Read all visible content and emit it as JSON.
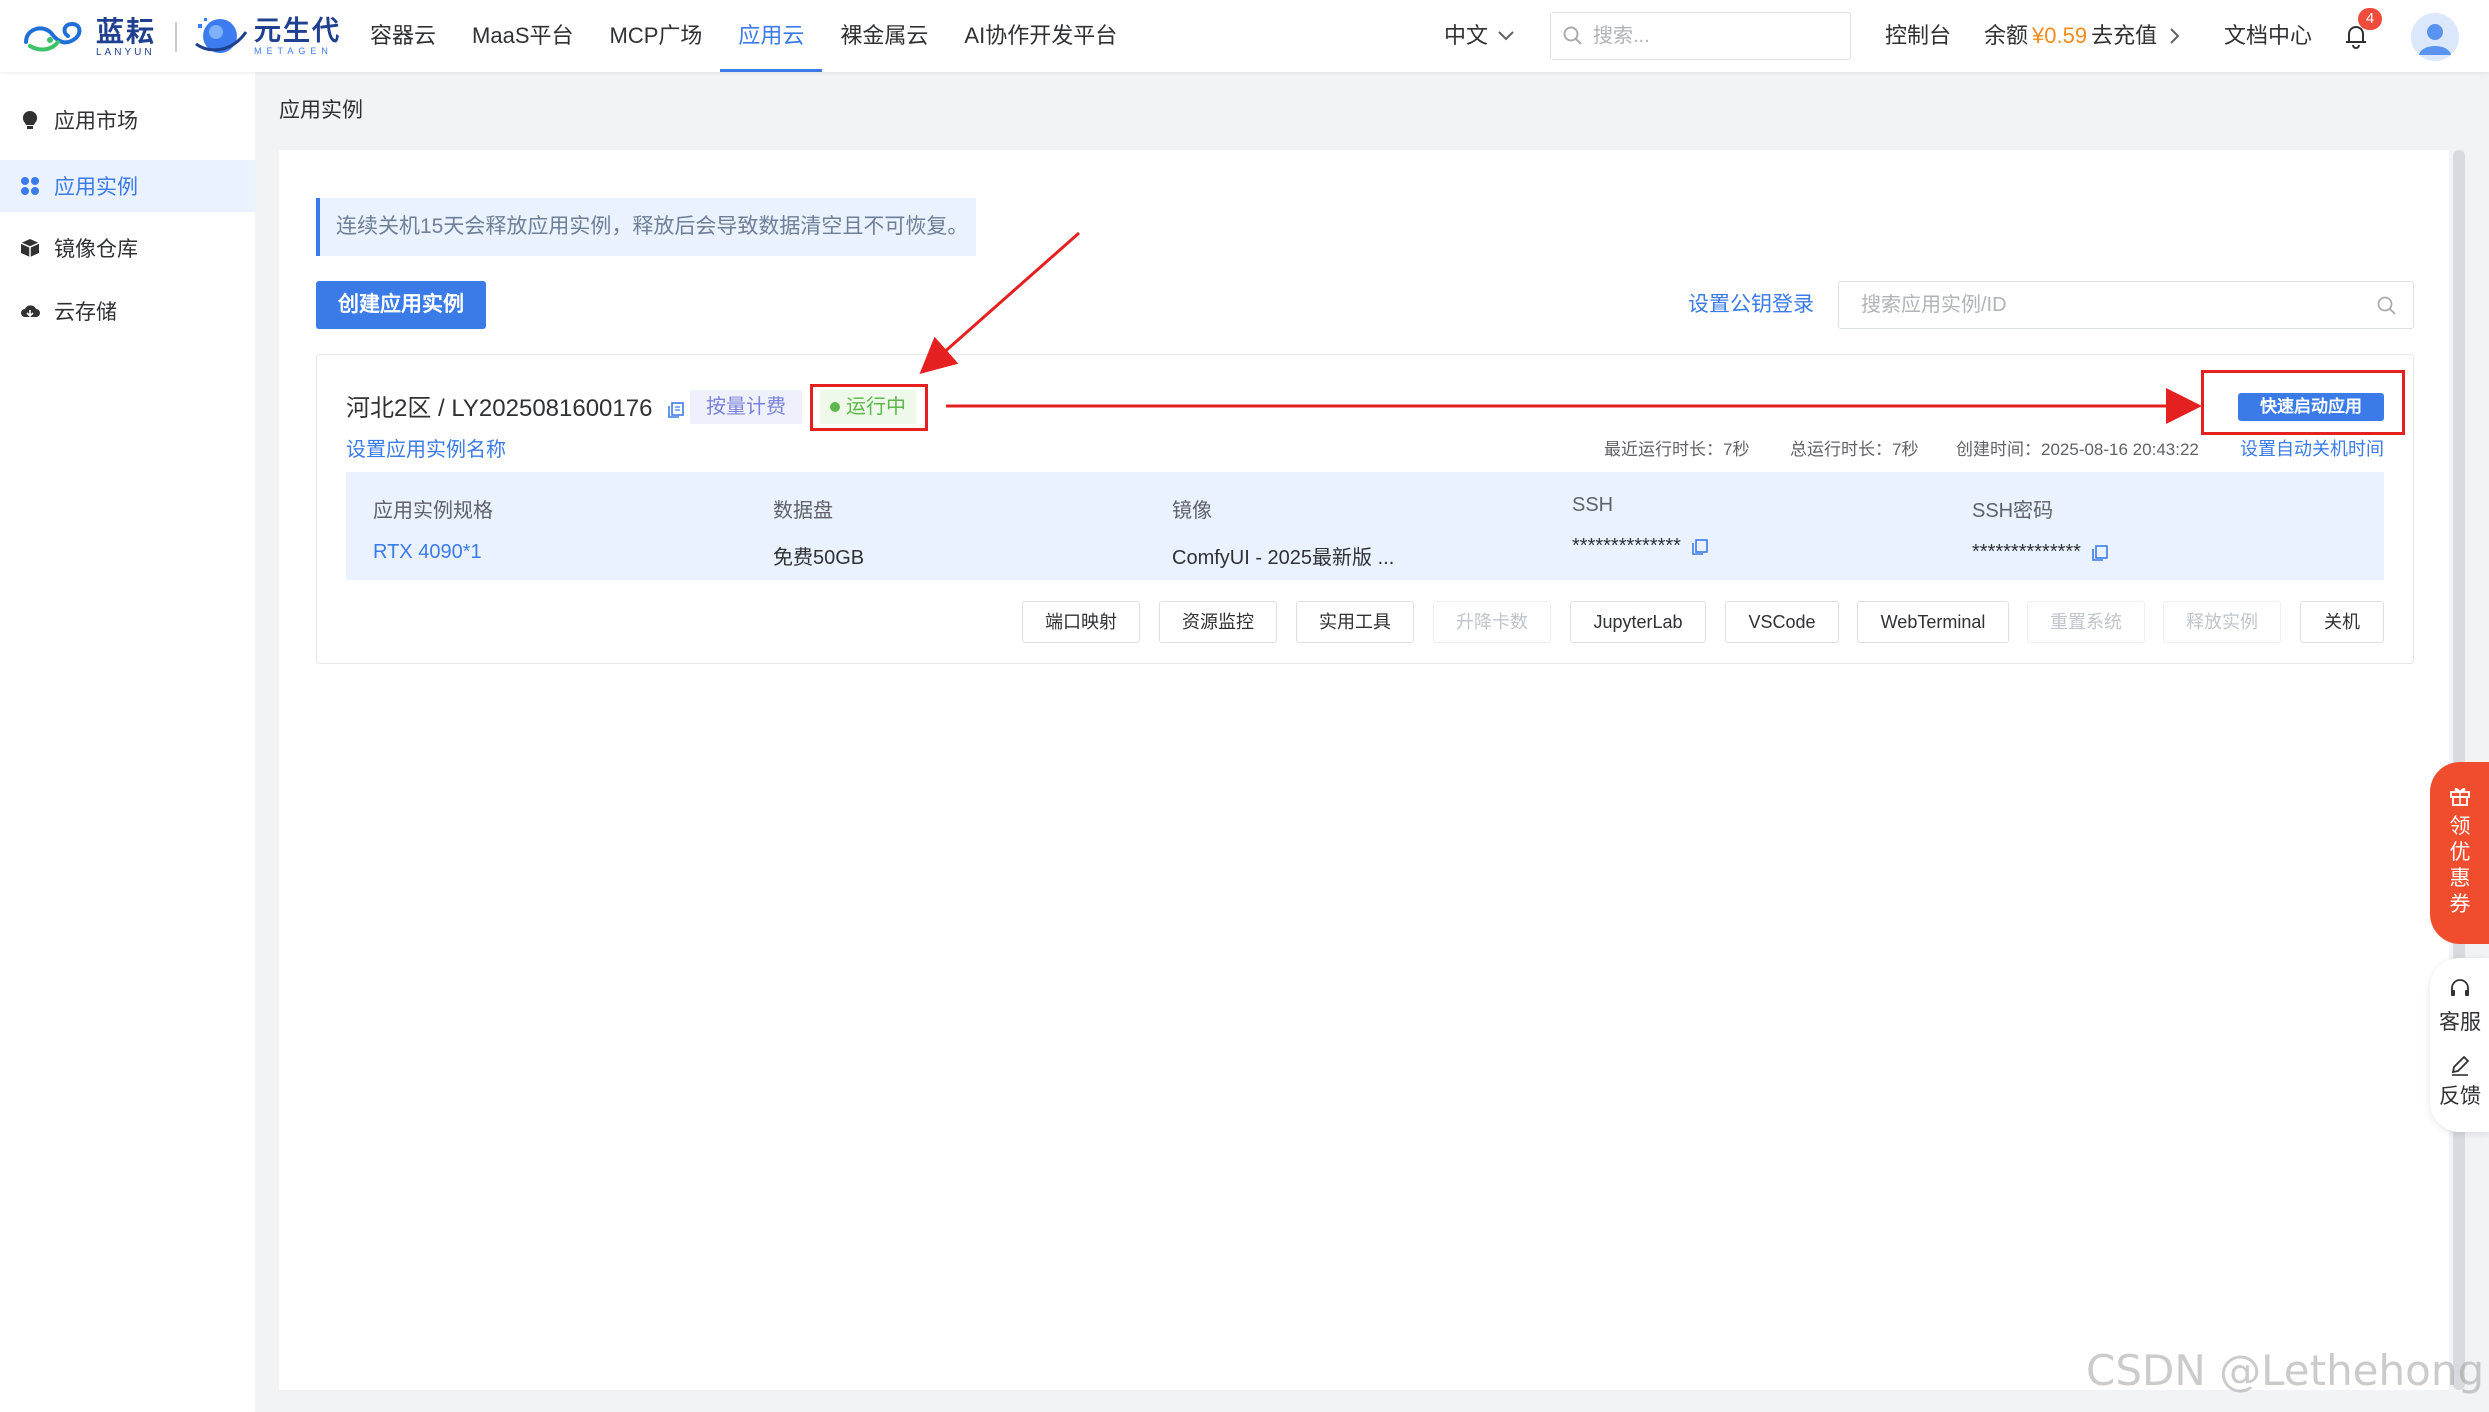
{
  "brand": {
    "logo1_cn": "蓝耘",
    "logo1_en": "LANYUN",
    "logo2_cn": "元生代",
    "logo2_en": "METAGEN"
  },
  "nav": {
    "items": [
      "容器云",
      "MaaS平台",
      "MCP广场",
      "应用云",
      "裸金属云",
      "AI协作开发平台"
    ],
    "active": "应用云"
  },
  "header": {
    "language": "中文",
    "search_placeholder": "搜索...",
    "console": "控制台",
    "balance_label": "余额",
    "balance_amount": "¥0.59",
    "recharge": "去充值",
    "docs": "文档中心",
    "notifications": "4"
  },
  "sidebar": {
    "items": [
      {
        "label": "应用市场",
        "icon": "lightbulb-icon"
      },
      {
        "label": "应用实例",
        "icon": "apps-icon"
      },
      {
        "label": "镜像仓库",
        "icon": "box-icon"
      },
      {
        "label": "云存储",
        "icon": "cloud-icon"
      }
    ],
    "active": "应用实例"
  },
  "page": {
    "breadcrumb": "应用实例",
    "notice": "连续关机15天会释放应用实例，释放后会导致数据清空且不可恢复。",
    "create_button": "创建应用实例",
    "pubkey_link": "设置公钥登录",
    "search_placeholder": "搜索应用实例/ID"
  },
  "instance": {
    "title": "河北2区 / LY2025081600176",
    "billing": "按量计费",
    "status": "运行中",
    "quick_launch": "快速启动应用",
    "rename": "设置应用实例名称",
    "recent_runtime": "最近运行时长：7秒",
    "total_runtime": "总运行时长：7秒",
    "created": "创建时间：2025-08-16 20:43:22",
    "auto_shutdown": "设置自动关机时间",
    "specs": [
      {
        "label": "应用实例规格",
        "value": "RTX 4090*1"
      },
      {
        "label": "数据盘",
        "value": "免费50GB"
      },
      {
        "label": "镜像",
        "value": "ComfyUI - 2025最新版 ..."
      },
      {
        "label": "SSH",
        "value": "**************"
      },
      {
        "label": "SSH密码",
        "value": "**************"
      }
    ],
    "actions": [
      {
        "label": "端口映射",
        "disabled": false
      },
      {
        "label": "资源监控",
        "disabled": false
      },
      {
        "label": "实用工具",
        "disabled": false
      },
      {
        "label": "升降卡数",
        "disabled": true
      },
      {
        "label": "JupyterLab",
        "disabled": false
      },
      {
        "label": "VSCode",
        "disabled": false
      },
      {
        "label": "WebTerminal",
        "disabled": false
      },
      {
        "label": "重置系统",
        "disabled": true
      },
      {
        "label": "释放实例",
        "disabled": true
      },
      {
        "label": "关机",
        "disabled": false
      }
    ]
  },
  "floating": {
    "coupon": [
      "领",
      "优",
      "惠",
      "券"
    ],
    "service": "客服",
    "feedback": "反馈"
  },
  "watermark": "CSDN @Lethehong",
  "colors": {
    "primary": "#3b7be8",
    "annotation_red": "#e42020",
    "running_green": "#5cb84a",
    "balance_orange": "#f08c1e",
    "coupon_red": "#f04d2e"
  }
}
